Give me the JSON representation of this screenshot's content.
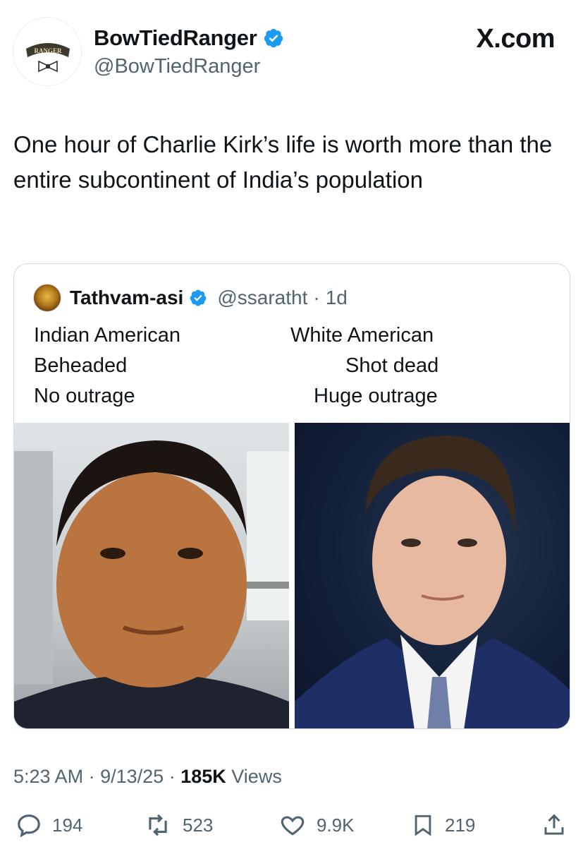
{
  "author": {
    "display_name": "BowTiedRanger",
    "handle": "@BowTiedRanger",
    "avatar_text": "RANGER"
  },
  "brand": "X.com",
  "post": {
    "text": "One hour of Charlie Kirk’s life is worth more than the entire subcontinent of India’s population"
  },
  "quoted": {
    "display_name": "Tathvam-asi",
    "handle": "@ssaratht",
    "separator": "·",
    "age": "1d",
    "left_lines": [
      "Indian American",
      "Beheaded",
      "No outrage"
    ],
    "right_lines": [
      "White American",
      "Shot dead",
      "Huge outrage"
    ]
  },
  "meta": {
    "time": "5:23 AM",
    "date": "9/13/25",
    "views_count": "185K",
    "views_label": "Views",
    "separator": "·"
  },
  "actions": {
    "replies": "194",
    "reposts": "523",
    "likes": "9.9K",
    "bookmarks": "219"
  },
  "colors": {
    "verified_blue": "#1d9bf0",
    "secondary_text": "#536471",
    "border": "#cfd9de"
  }
}
